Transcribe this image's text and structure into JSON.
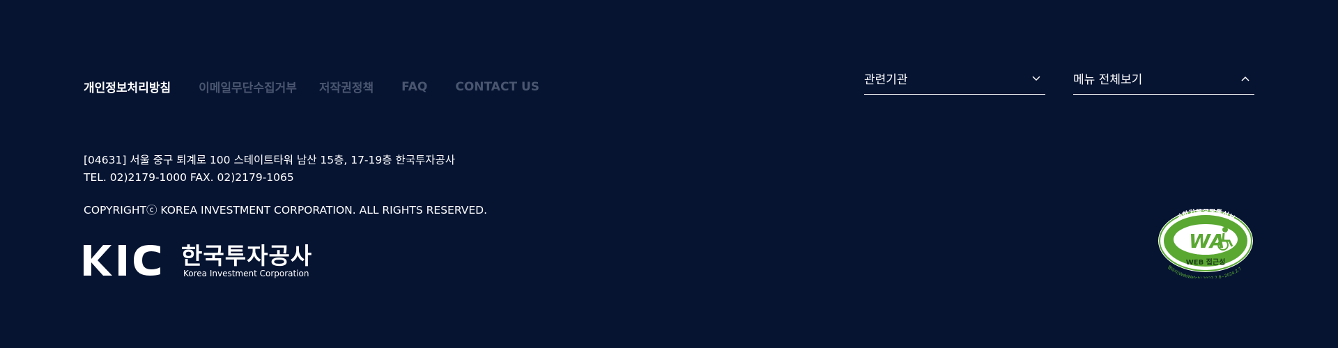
{
  "footer_nav": {
    "privacy": "개인정보처리방침",
    "email_refusal": "이메일무단수집거부",
    "copyright_policy": "저작권정책",
    "faq": "FAQ",
    "contact": "CONTACT US"
  },
  "dropdowns": {
    "related": "관련기관",
    "menu_all": "메뉴 전체보기"
  },
  "address": {
    "line1": "[04631] 서울 중구 퇴계로 100 스테이트타워 남산 15층, 17-19층 한국투자공사",
    "line2": "TEL. 02)2179-1000 FAX. 02)2179-1065"
  },
  "copyright": "COPYRIGHTⓒ KOREA INVESTMENT CORPORATION. ALL RIGHTS RESERVED.",
  "logo": {
    "mark": "KIC",
    "title_kr": "한국투자공사",
    "subtitle_en": "Korea Investment Corporation"
  },
  "wa_badge": {
    "top_text": "과학기술정보통신부",
    "mark": "WA",
    "label": "WEB 접근성",
    "bottom_text": "웹와치(WebWatch) 2023.2.8~2024.2.7"
  },
  "colors": {
    "background": "#061432",
    "nav_inactive": "#4a5670",
    "badge_green": "#5aa832"
  }
}
